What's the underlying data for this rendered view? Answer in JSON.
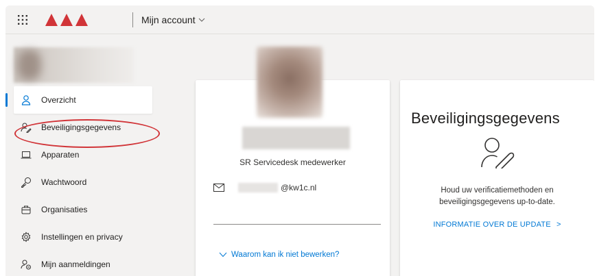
{
  "header": {
    "app_title": "Mijn account",
    "brand_color": "#d13438"
  },
  "sidebar": {
    "items": [
      {
        "label": "Overzicht",
        "icon": "person-icon",
        "active": true
      },
      {
        "label": "Beveiligingsgegevens",
        "icon": "person-key-icon",
        "highlighted": true
      },
      {
        "label": "Apparaten",
        "icon": "laptop-icon"
      },
      {
        "label": "Wachtwoord",
        "icon": "key-icon"
      },
      {
        "label": "Organisaties",
        "icon": "briefcase-icon"
      },
      {
        "label": "Instellingen en privacy",
        "icon": "gear-icon"
      },
      {
        "label": "Mijn aanmeldingen",
        "icon": "person-sync-icon"
      }
    ]
  },
  "profile_card": {
    "job_title": "SR Servicedesk medewerker",
    "email_suffix": "@kw1c.nl",
    "why_link": "Waarom kan ik niet bewerken?"
  },
  "security_card": {
    "title": "Beveiligingsgegevens",
    "description_line1": "Houd uw verificatiemethoden en",
    "description_line2": "beveiligingsgegevens up-to-date.",
    "link": "INFORMATIE OVER DE UPDATE",
    "link_arrow": ">"
  },
  "colors": {
    "accent": "#0078d4",
    "highlight_ring": "#d13438",
    "background": "#f3f2f1"
  }
}
